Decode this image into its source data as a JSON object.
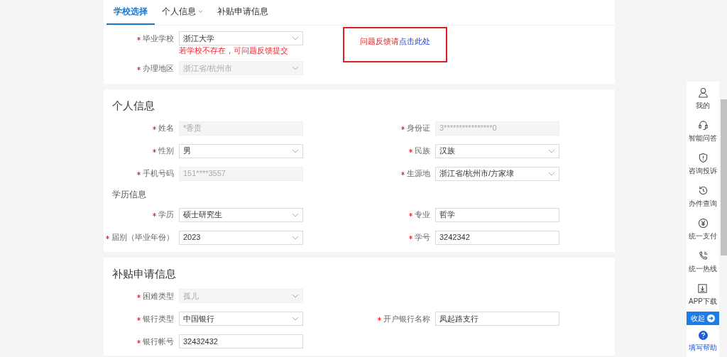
{
  "tabs": [
    {
      "label": "学校选择",
      "selected": true,
      "dropdown": false
    },
    {
      "label": "个人信息",
      "selected": false,
      "dropdown": true
    },
    {
      "label": "补贴申请信息",
      "selected": false,
      "dropdown": false
    }
  ],
  "school_section": {
    "fields": [
      {
        "label": "毕业学校",
        "value": "浙江大学",
        "kind": "select",
        "disabled": false,
        "required": true,
        "hint": "若学校不存在，可问题反馈提交"
      },
      {
        "label": "办理地区",
        "value": "浙江省/杭州市",
        "kind": "select",
        "disabled": true,
        "required": true
      }
    ],
    "feedback": {
      "text": "问题反馈请",
      "link": "点击此处"
    }
  },
  "sections": [
    {
      "title": "个人信息",
      "groups": [
        {
          "fields": [
            {
              "label": "姓名",
              "value": "*香贵",
              "kind": "input",
              "disabled": true,
              "required": true
            },
            {
              "label": "身份证",
              "value": "3****************0",
              "kind": "input",
              "disabled": true,
              "required": true
            },
            {
              "label": "性别",
              "value": "男",
              "kind": "select",
              "disabled": false,
              "required": true
            },
            {
              "label": "民族",
              "value": "汉族",
              "kind": "select",
              "disabled": false,
              "required": true
            },
            {
              "label": "手机号码",
              "value": "151****3557",
              "kind": "input",
              "disabled": true,
              "required": true
            },
            {
              "label": "生源地",
              "value": "浙江省/杭州市/方家埭",
              "kind": "select",
              "disabled": false,
              "required": true
            }
          ]
        },
        {
          "subtitle": "学历信息",
          "fields": [
            {
              "label": "学历",
              "value": "硕士研究生",
              "kind": "select",
              "disabled": false,
              "required": true
            },
            {
              "label": "专业",
              "value": "哲学",
              "kind": "input",
              "disabled": false,
              "required": true
            },
            {
              "label": "届别（毕业年份）",
              "value": "2023",
              "kind": "select",
              "disabled": false,
              "required": true
            },
            {
              "label": "学号",
              "value": "3242342",
              "kind": "input",
              "disabled": false,
              "required": true
            }
          ]
        }
      ]
    },
    {
      "title": "补贴申请信息",
      "groups": [
        {
          "fields": [
            {
              "label": "困难类型",
              "value": "孤儿",
              "kind": "select",
              "disabled": true,
              "required": true
            },
            {
              "kind": "empty"
            },
            {
              "label": "银行类型",
              "value": "中国银行",
              "kind": "select",
              "disabled": false,
              "required": true
            },
            {
              "label": "开户银行名称",
              "value": "凤起路支行",
              "kind": "input",
              "disabled": false,
              "required": true
            },
            {
              "label": "银行帐号",
              "value": "32432432",
              "kind": "input",
              "disabled": false,
              "required": true
            }
          ]
        }
      ]
    }
  ],
  "sidebar": {
    "items": [
      {
        "label": "我的"
      },
      {
        "label": "智能问答"
      },
      {
        "label": "咨询投诉"
      },
      {
        "label": "办件查询"
      },
      {
        "label": "统一支付"
      },
      {
        "label": "统一热线"
      },
      {
        "label": "APP下载"
      }
    ],
    "collapse": "收起",
    "help": "填写帮助"
  }
}
